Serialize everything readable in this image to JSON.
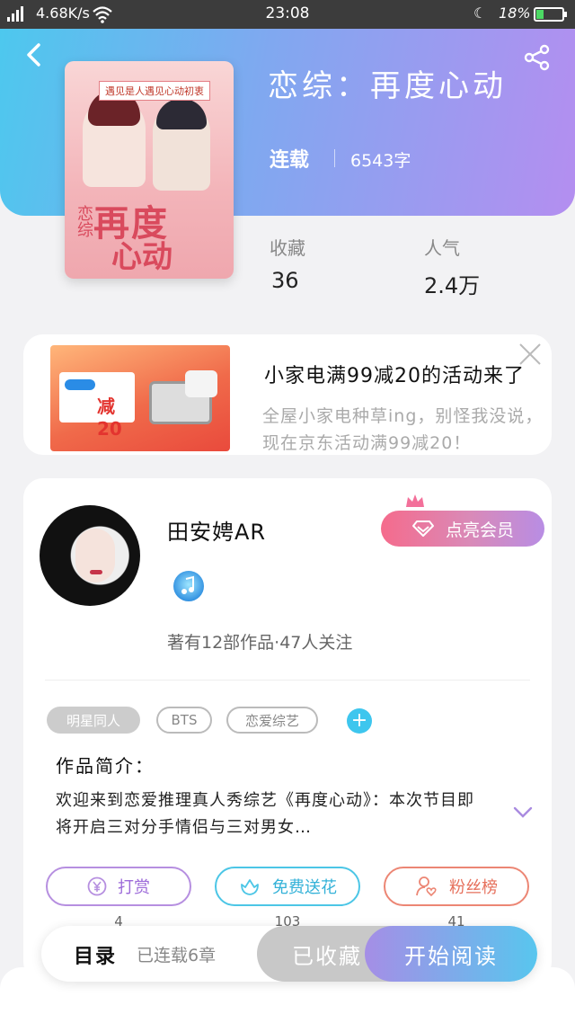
{
  "status_bar": {
    "network": "4.68K/s",
    "time": "23:08",
    "battery": "18%"
  },
  "book": {
    "title": "恋综：再度心动",
    "status": "连载",
    "word_count": "6543字",
    "stats": [
      {
        "label": "收藏",
        "value": "36"
      },
      {
        "label": "人气",
        "value": "2.4万"
      }
    ],
    "cover": {
      "tagline": "遇见是人遇见心动初衷",
      "title_line1": "再度",
      "title_line2": "心动",
      "prefix": "恋综"
    }
  },
  "ad": {
    "image_text": "减20",
    "title": "小家电满99减20的活动来了",
    "description": "全屋小家电种草ing，别怪我没说，现在京东活动满99减20！"
  },
  "author": {
    "name": "田安娉AR",
    "vip_button": "点亮会员",
    "stats": "著有12部作品·47人关注",
    "tags": [
      "明星同人",
      "BTS",
      "恋爱综艺"
    ],
    "tag_add": "+",
    "intro_label": "作品简介：",
    "intro_text": "欢迎来到恋爱推理真人秀综艺《再度心动》：本次节目即将开启三对分手情侣与三对男女…",
    "actions": [
      {
        "label": "打赏",
        "count": "4"
      },
      {
        "label": "免费送花",
        "count": "103"
      },
      {
        "label": "粉丝榜",
        "count": "41"
      }
    ]
  },
  "bottom_bar": {
    "toc_label": "目录",
    "toc_count": "已连载6章",
    "favorite_button": "已收藏",
    "read_button": "开始阅读"
  },
  "colors": {
    "header_start": "#4dc8ee",
    "header_end": "#b48ef0",
    "vip_pink": "#f56b8c",
    "accent_cyan": "#3ec6ee"
  },
  "icons": [
    "back-icon",
    "share-icon",
    "close-icon",
    "crown-icon",
    "diamond-icon",
    "music-medal-icon",
    "yen-icon",
    "flower-icon",
    "person-heart-icon",
    "chevron-down-icon",
    "wifi-icon",
    "moon-icon",
    "battery-icon"
  ]
}
